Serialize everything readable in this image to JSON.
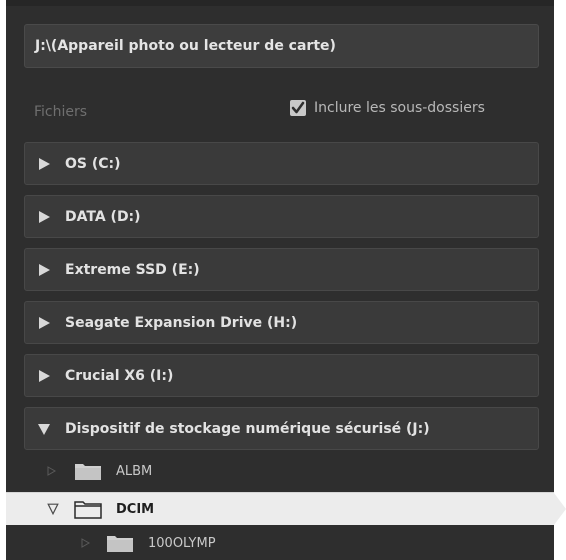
{
  "source": {
    "label": "J:\\(Appareil photo ou lecteur de carte)"
  },
  "files": {
    "label": "Fichiers",
    "include_subfolders_label": "Inclure les sous-dossiers",
    "include_subfolders_checked": true
  },
  "drives": [
    {
      "label": "OS (C:)",
      "expanded": false
    },
    {
      "label": "DATA (D:)",
      "expanded": false
    },
    {
      "label": "Extreme SSD (E:)",
      "expanded": false
    },
    {
      "label": "Seagate Expansion Drive (H:)",
      "expanded": false
    },
    {
      "label": "Crucial X6 (I:)",
      "expanded": false
    },
    {
      "label": "Dispositif de stockage numérique sécurisé (J:)",
      "expanded": true
    }
  ],
  "folders": [
    {
      "label": "ALBM",
      "selected": false,
      "expanded": false
    },
    {
      "label": "DCIM",
      "selected": true,
      "expanded": true
    },
    {
      "label": "100OLYMP",
      "selected": false,
      "expanded": false
    }
  ]
}
